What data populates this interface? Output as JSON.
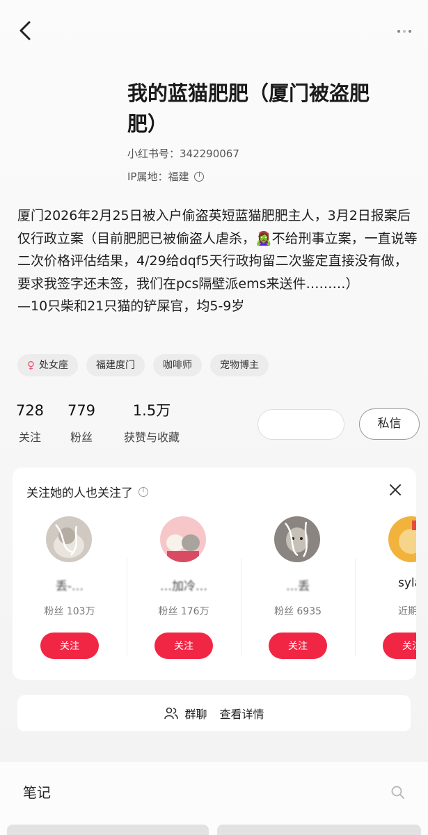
{
  "profile": {
    "name": "我的蓝猫肥肥（厦门被盗肥肥）",
    "redbook_id": "小红书号：342290067",
    "ip_location": "IP属地：福建",
    "bio": "厦门2026年2月25日被入户偷盗英短蓝猫肥肥主人，3月2日报案后仅行政立案（目前肥肥已被偷盗人虐杀，🧟‍♀️不给刑事立案，一直说等二次价格评估结果，4/29给dqf5天行政拘留二次鉴定直接没有做，要求我签字还未签，我们在pcs隔壁派ems来送件………）\n—10只柴和21只猫的铲屎官，均5-9岁",
    "tags": [
      "处女座",
      "福建度门",
      "咖啡师",
      "宠物博主"
    ]
  },
  "stats": [
    {
      "value": "728",
      "label": "关注"
    },
    {
      "value": "779",
      "label": "粉丝"
    },
    {
      "value": "1.5万",
      "label": "获赞与收藏"
    }
  ],
  "actions": {
    "message_label": "私信"
  },
  "recommend": {
    "title": "关注她的人也关注了",
    "users": [
      {
        "name": "丢-…",
        "fans": "粉丝 103万",
        "button": "关注"
      },
      {
        "name": "…加冷…",
        "fans": "粉丝 176万",
        "button": "关注"
      },
      {
        "name": "…丢",
        "fans": "粉丝 6935",
        "button": "关注"
      },
      {
        "name": "syla",
        "fans": "近期互动",
        "button": "关注"
      }
    ]
  },
  "group": {
    "label": "群聊",
    "detail": "查看详情"
  },
  "notes": {
    "tab_label": "笔记"
  },
  "colors": {
    "accent": "#f12645",
    "female": "#e8506a"
  }
}
